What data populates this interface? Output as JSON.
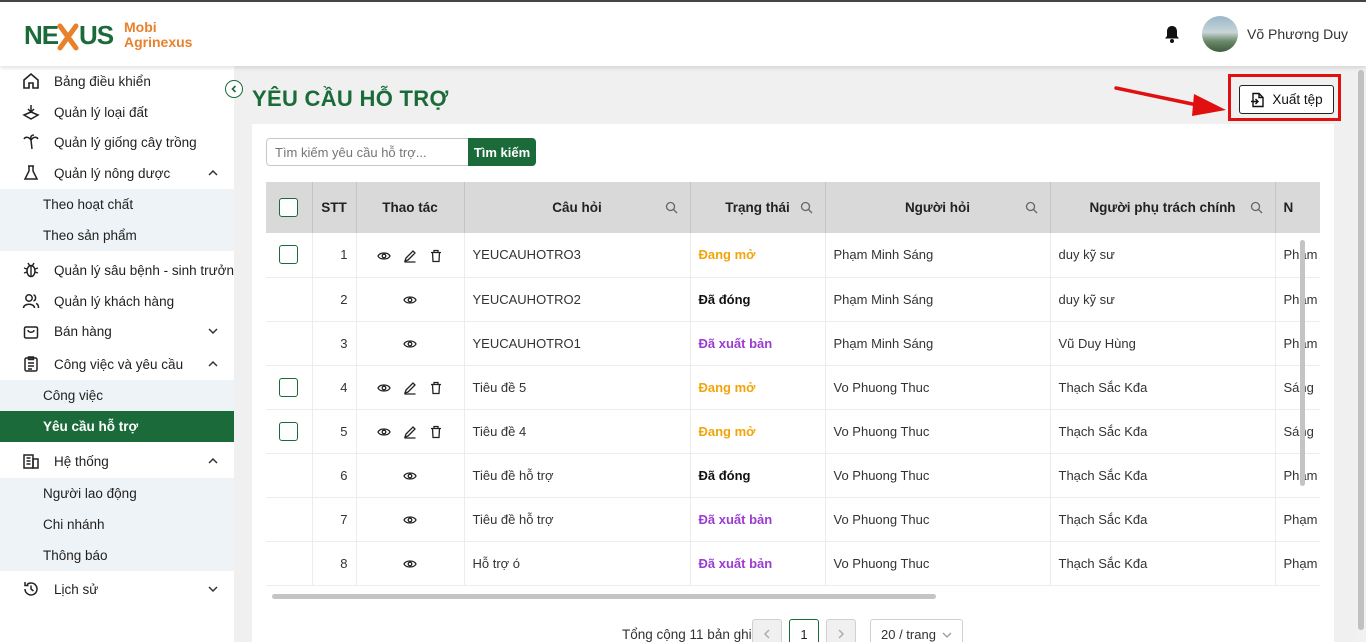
{
  "brand": {
    "line1": "Mobi",
    "line2": "Agrinexus"
  },
  "user": {
    "name": "Võ Phương Duy"
  },
  "sidebar": {
    "items": [
      {
        "label": "Bảng điều khiển",
        "icon": "home-icon"
      },
      {
        "label": "Quản lý loại đất",
        "icon": "soil-icon"
      },
      {
        "label": "Quản lý giống cây trồng",
        "icon": "palm-tree-icon"
      },
      {
        "label": "Quản lý nông dược",
        "icon": "flask-icon",
        "expanded": true
      },
      {
        "label": "Quản lý sâu bệnh - sinh trưởng",
        "icon": "bug-icon"
      },
      {
        "label": "Quản lý khách hàng",
        "icon": "users-icon"
      },
      {
        "label": "Bán hàng",
        "icon": "shopping-bag-icon",
        "expanded": false
      },
      {
        "label": "Công việc và yêu cầu",
        "icon": "clipboard-icon",
        "expanded": true
      },
      {
        "label": "Hệ thống",
        "icon": "building-icon",
        "expanded": true
      },
      {
        "label": "Lịch sử",
        "icon": "history-icon",
        "expanded": false
      }
    ],
    "sub_pesticide": [
      "Theo hoạt chất",
      "Theo sản phẩm"
    ],
    "sub_work": [
      "Công việc",
      "Yêu cầu hỗ trợ"
    ],
    "sub_system": [
      "Người lao động",
      "Chi nhánh",
      "Thông báo"
    ]
  },
  "page": {
    "title": "YÊU CẦU HỖ TRỢ",
    "export_label": "Xuất tệp"
  },
  "search": {
    "placeholder": "Tìm kiếm yêu cầu hỗ trợ...",
    "button": "Tìm kiếm"
  },
  "table": {
    "columns": [
      "STT",
      "Thao tác",
      "Câu hỏi",
      "Trạng thái",
      "Người hỏi",
      "Người phụ trách chính",
      "N"
    ],
    "rows": [
      {
        "stt": "1",
        "editable": true,
        "question": "YEUCAUHOTRO3",
        "status": "Đang mở",
        "status_type": "open",
        "asker": "Phạm Minh Sáng",
        "owner": "duy kỹ sư",
        "extra": "Phạm"
      },
      {
        "stt": "2",
        "editable": false,
        "question": "YEUCAUHOTRO2",
        "status": "Đã đóng",
        "status_type": "closed",
        "asker": "Phạm Minh Sáng",
        "owner": "duy kỹ sư",
        "extra": "Phạm"
      },
      {
        "stt": "3",
        "editable": false,
        "question": "YEUCAUHOTRO1",
        "status": "Đã xuất bản",
        "status_type": "published",
        "asker": "Phạm Minh Sáng",
        "owner": "Vũ Duy Hùng",
        "extra": "Phạm"
      },
      {
        "stt": "4",
        "editable": true,
        "question": "Tiêu đề 5",
        "status": "Đang mở",
        "status_type": "open",
        "asker": "Vo Phuong Thuc",
        "owner": "Thạch Sắc Kđa",
        "extra": "Sáng"
      },
      {
        "stt": "5",
        "editable": true,
        "question": "Tiêu đề 4",
        "status": "Đang mở",
        "status_type": "open",
        "asker": "Vo Phuong Thuc",
        "owner": "Thạch Sắc Kđa",
        "extra": "Sáng"
      },
      {
        "stt": "6",
        "editable": false,
        "question": "Tiêu đề hỗ trợ",
        "status": "Đã đóng",
        "status_type": "closed",
        "asker": "Vo Phuong Thuc",
        "owner": "Thạch Sắc Kđa",
        "extra": "Phạm"
      },
      {
        "stt": "7",
        "editable": false,
        "question": "Tiêu đề hỗ trợ",
        "status": "Đã xuất bản",
        "status_type": "published",
        "asker": "Vo Phuong Thuc",
        "owner": "Thạch Sắc Kđa",
        "extra": "Phạm"
      },
      {
        "stt": "8",
        "editable": false,
        "question": "Hỗ trợ ó",
        "status": "Đã xuất bản",
        "status_type": "published",
        "asker": "Vo Phuong Thuc",
        "owner": "Thạch Sắc Kđa",
        "extra": "Phạm"
      }
    ]
  },
  "pagination": {
    "total": "Tổng cộng 11 bản ghi",
    "page": "1",
    "page_size": "20 / trang"
  },
  "colors": {
    "primary": "#1b6b3a",
    "brand": "#e8812b",
    "open": "#f2a40a",
    "published": "#9a3bd1",
    "highlight": "#e01010"
  }
}
